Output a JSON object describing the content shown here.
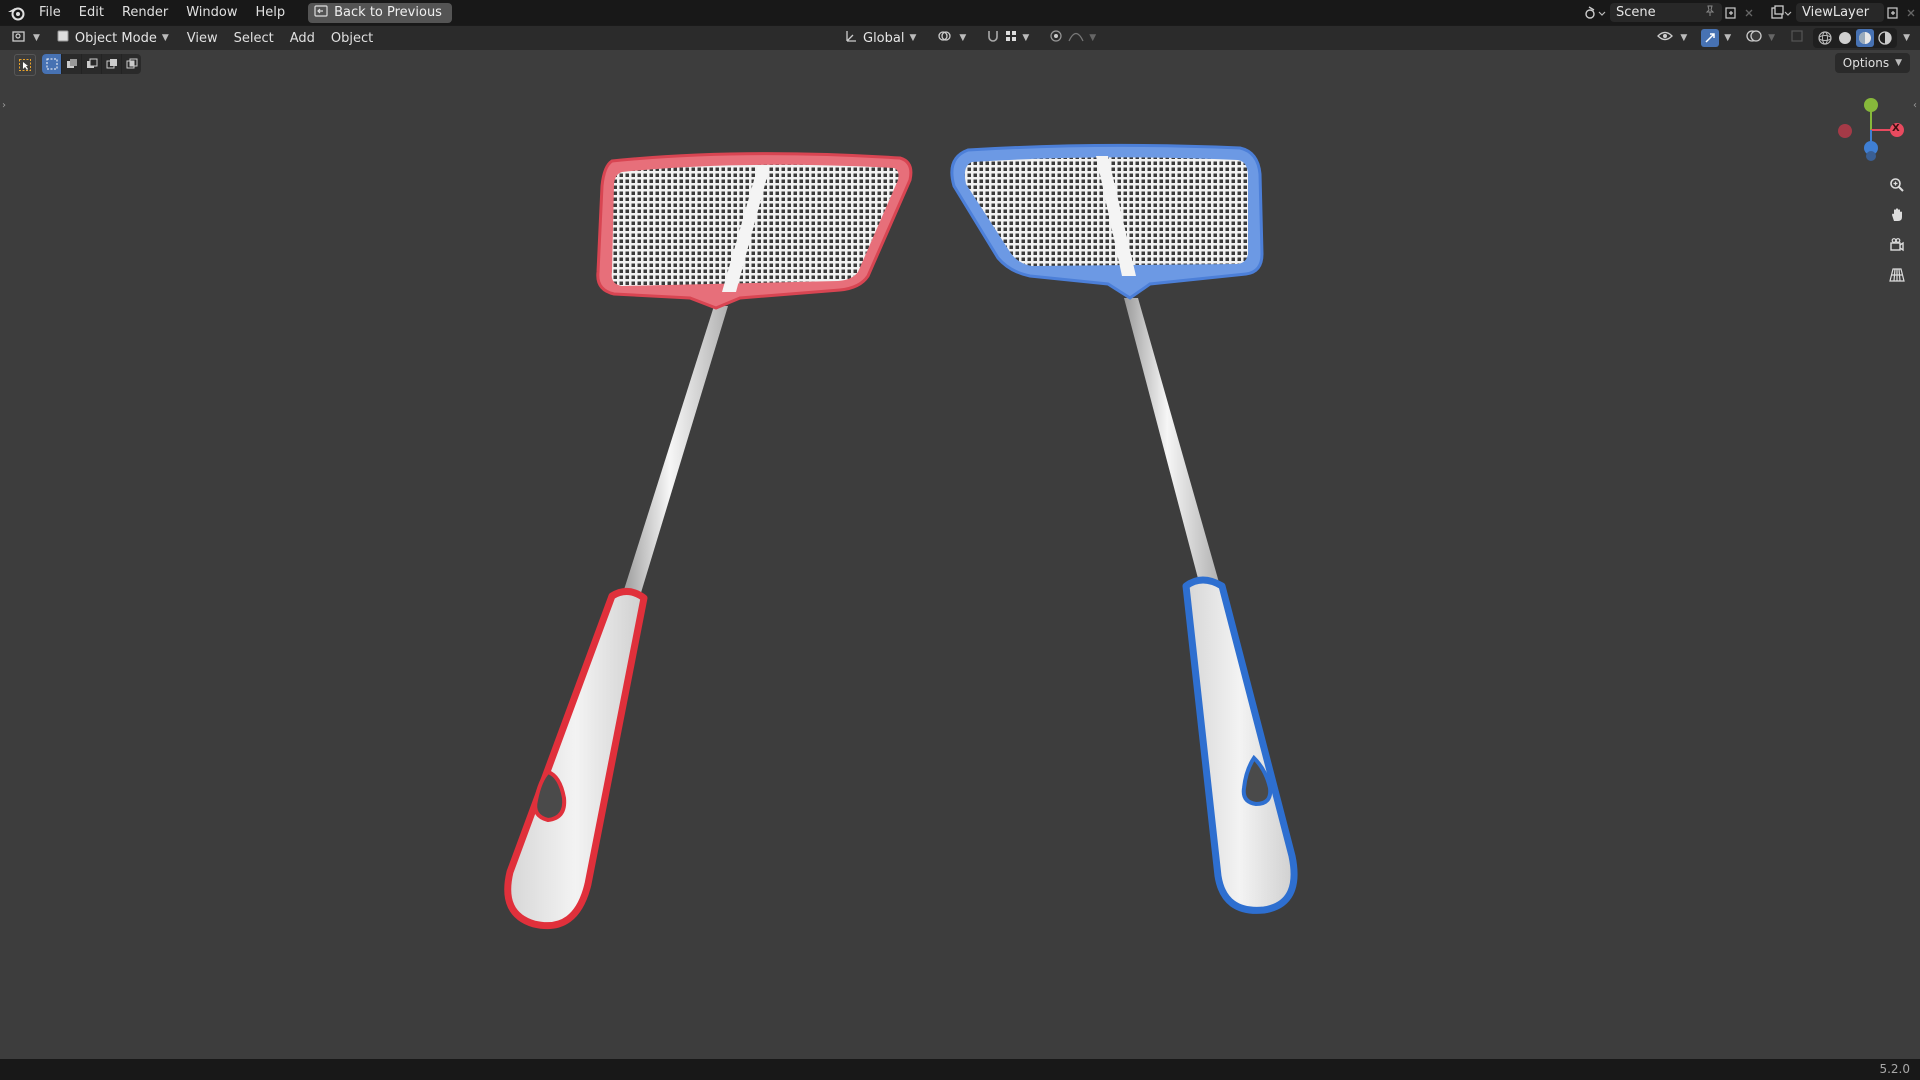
{
  "topbar": {
    "menus": [
      "File",
      "Edit",
      "Render",
      "Window",
      "Help"
    ],
    "back_button": "Back to Previous",
    "scene_name": "Scene",
    "view_layer_name": "ViewLayer"
  },
  "viewport_header": {
    "mode": "Object Mode",
    "menus": [
      "View",
      "Select",
      "Add",
      "Object"
    ],
    "transform_orientation": "Global"
  },
  "tool_settings": {
    "options_label": "Options"
  },
  "gizmo": {
    "x_label": "X",
    "colors": {
      "x": "#e84a5f",
      "y": "#87b83b",
      "z": "#3f7fd4"
    }
  },
  "scene_objects": [
    {
      "name": "red fly swatter",
      "accent": "#e8454f"
    },
    {
      "name": "blue fly swatter",
      "accent": "#3d7fd6"
    }
  ],
  "status": {
    "version": "5.2.0"
  },
  "icons": [
    "blender-logo-icon",
    "back-icon",
    "scene-icon",
    "pin-icon",
    "new-scene-icon",
    "close-icon",
    "view-layer-icon",
    "editor-type-icon",
    "object-mode-icon",
    "transform-orientation-icon",
    "pivot-icon",
    "snap-icon",
    "proportional-edit-icon",
    "visibility-icon",
    "gizmo-icon",
    "overlay-icon",
    "xray-icon",
    "shading-wireframe-icon",
    "shading-solid-icon",
    "shading-material-icon",
    "shading-rendered-icon",
    "zoom-icon",
    "pan-icon",
    "camera-icon",
    "perspective-grid-icon"
  ]
}
